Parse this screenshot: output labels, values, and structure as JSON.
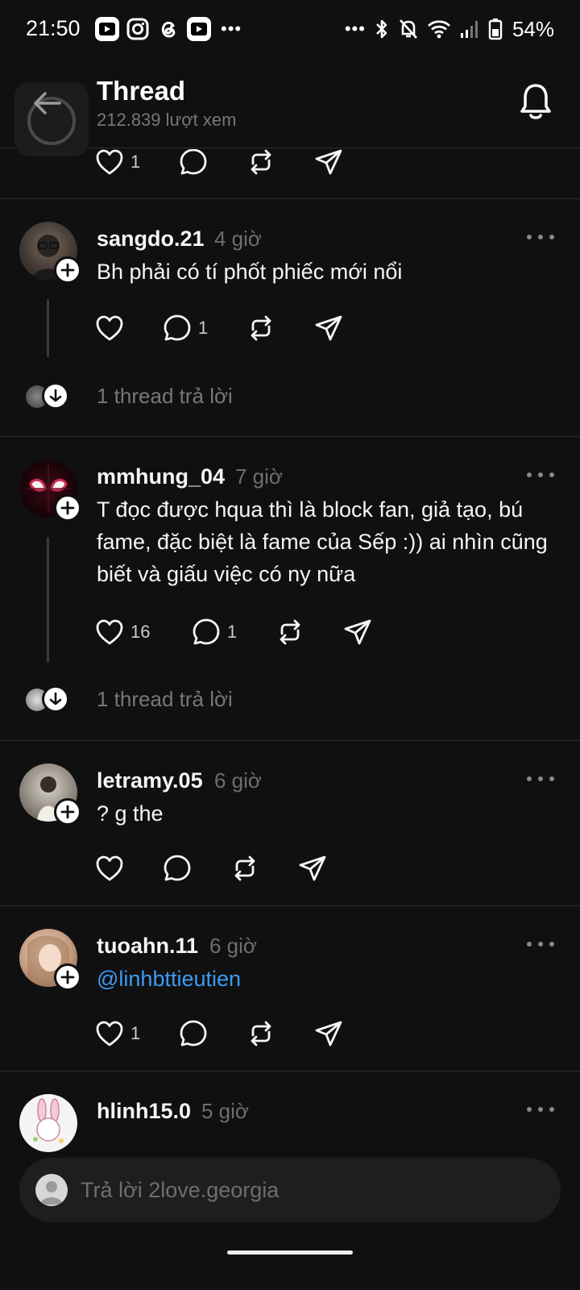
{
  "status_bar": {
    "time": "21:50",
    "battery": "54%",
    "icons": [
      "tiktok-icon",
      "instagram-icon",
      "threads-icon",
      "tiktok-icon",
      "more-icon"
    ]
  },
  "header": {
    "title": "Thread",
    "views": "212.839 lượt xem"
  },
  "top_post": {
    "likes": "1"
  },
  "posts": [
    {
      "username": "sangdo.21",
      "time": "4 giờ",
      "text": "Bh phải có tí phốt phiếc mới nổi",
      "likes": "",
      "replies": "1",
      "reply_summary": "1 thread trả lời"
    },
    {
      "username": "mmhung_04",
      "time": "7 giờ",
      "text": "T đọc được hqua thì là block fan, giả tạo, bú fame, đặc biệt là fame của Sếp :)) ai nhìn cũng biết và giấu việc có ny nữa",
      "likes": "16",
      "replies": "1",
      "reply_summary": "1 thread trả lời"
    },
    {
      "username": "letramy.05",
      "time": "6 giờ",
      "text": "? g the",
      "likes": "",
      "replies": ""
    },
    {
      "username": "tuoahn.11",
      "time": "6 giờ",
      "text": "@linhbttieutien",
      "likes": "1",
      "replies": ""
    },
    {
      "username": "hlinh15.0",
      "time": "5 giờ"
    }
  ],
  "composer": {
    "placeholder": "Trả lời 2love.georgia"
  },
  "colors": {
    "background": "#101010",
    "mention": "#3d9bf2",
    "muted_text": "#6e6e6e"
  }
}
